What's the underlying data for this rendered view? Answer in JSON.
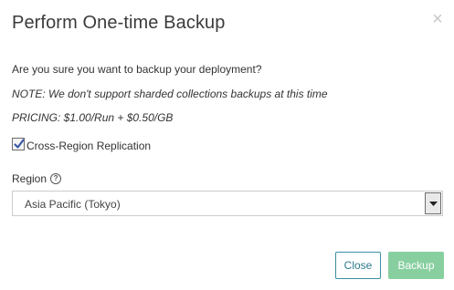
{
  "modal": {
    "title": "Perform One-time Backup",
    "close_icon": "close-icon",
    "confirm_text": "Are you sure you want to backup your deployment?",
    "note_text": "NOTE: We don't support sharded collections backups at this time",
    "pricing_text": "PRICING: $1.00/Run + $0.50/GB",
    "replication": {
      "label": "Cross-Region Replication",
      "checked": true
    },
    "region": {
      "label": "Region",
      "help_icon": "question-circle-icon",
      "selected": "Asia Pacific (Tokyo)"
    },
    "buttons": {
      "close_label": "Close",
      "backup_label": "Backup"
    }
  },
  "colors": {
    "close_button_border": "#3a8fa3",
    "backup_button_bg": "#88cfa0",
    "title_text": "#3b3b3b"
  }
}
